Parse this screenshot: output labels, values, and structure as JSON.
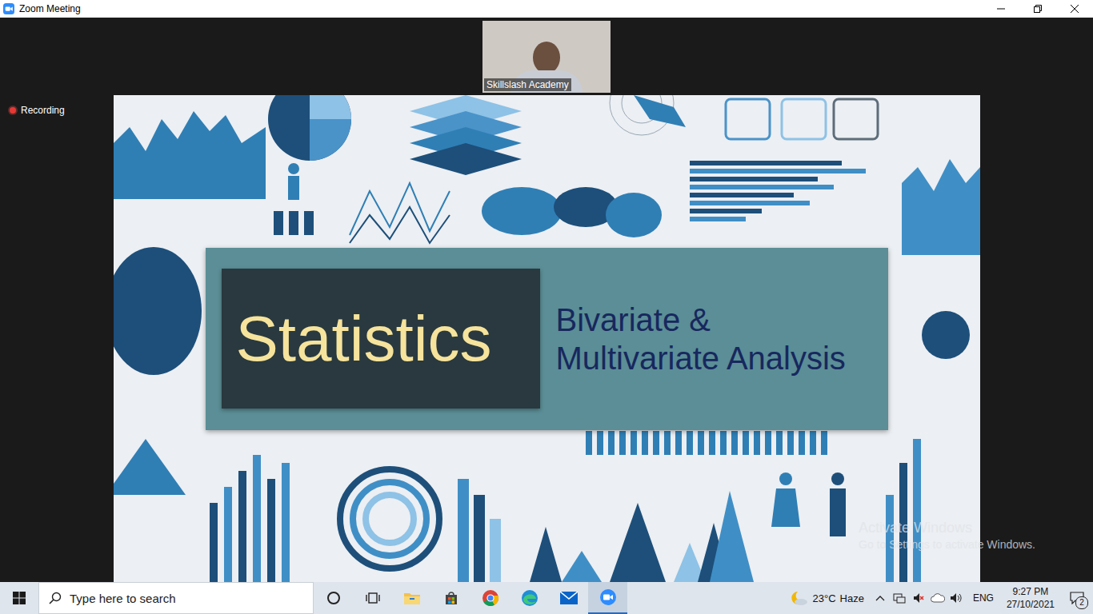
{
  "window": {
    "title": "Zoom Meeting"
  },
  "recording": {
    "label": "Recording",
    "active": true
  },
  "participant": {
    "name": "Skillslash Academy"
  },
  "slide": {
    "title": "Statistics",
    "subtitle_lines": [
      "Bivariate &",
      "Multivariate Analysis"
    ]
  },
  "watermark": {
    "title": "Activate Windows",
    "message": "Go to Settings to activate Windows."
  },
  "taskbar": {
    "search": {
      "placeholder": "Type here to search"
    },
    "apps": [
      {
        "kind": "cortana",
        "active": false
      },
      {
        "kind": "taskview",
        "active": false
      },
      {
        "kind": "explorer",
        "active": false
      },
      {
        "kind": "store",
        "active": false
      },
      {
        "kind": "chrome",
        "active": false
      },
      {
        "kind": "edge",
        "active": false
      },
      {
        "kind": "mail",
        "active": false
      },
      {
        "kind": "zoom",
        "active": true
      }
    ],
    "weather": {
      "temperature": "23°C",
      "condition": "Haze"
    },
    "language": "ENG",
    "clock": {
      "time": "9:27 PM",
      "date": "27/10/2021"
    },
    "notifications": {
      "count": "2"
    }
  }
}
